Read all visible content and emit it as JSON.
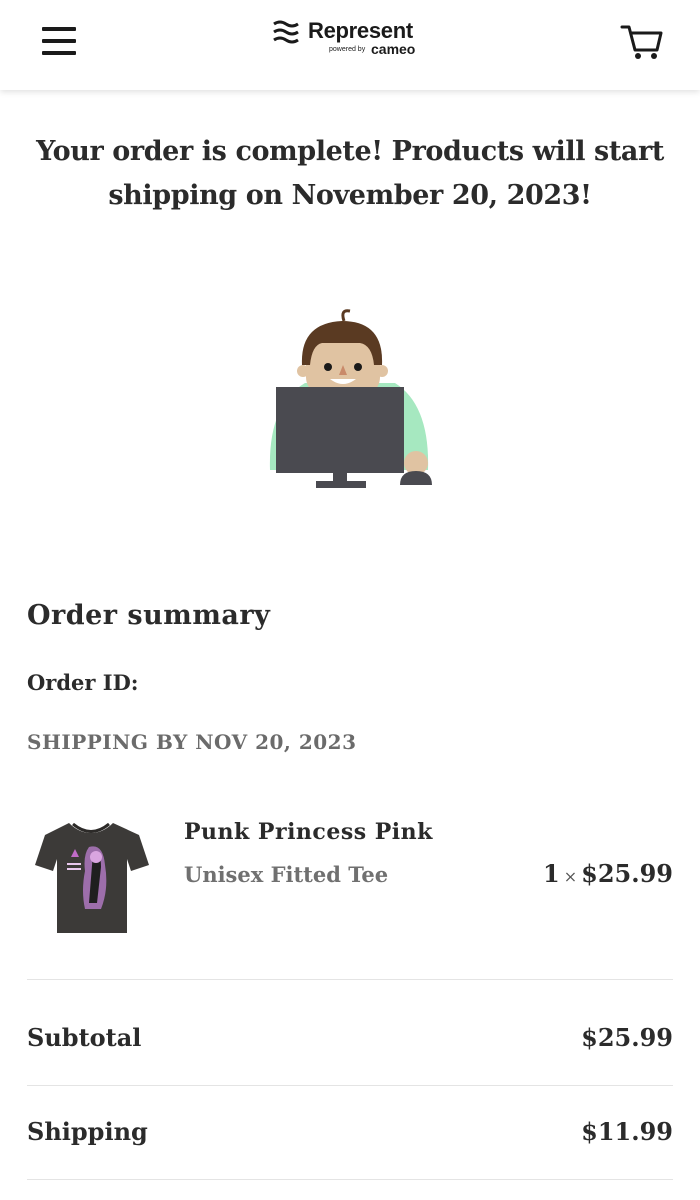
{
  "header": {
    "brand_name": "Represent",
    "brand_powered_by": "powered by",
    "brand_partner": "cameo",
    "menu_icon": "hamburger-menu-icon",
    "cart_icon": "shopping-cart-icon"
  },
  "confirmation": {
    "line1": "Your order is complete! Products will start",
    "line2": "shipping on November 20, 2023!"
  },
  "summary": {
    "heading": "Order summary",
    "order_id_label": "Order ID:",
    "order_id_value": "",
    "shipping_by": "SHIPPING BY NOV 20, 2023"
  },
  "items": [
    {
      "name": "Punk Princess Pink",
      "variant": "Unisex Fitted Tee",
      "quantity": "1",
      "times_symbol": "×",
      "price": "$25.99"
    }
  ],
  "totals": {
    "subtotal_label": "Subtotal",
    "subtotal_value": "$25.99",
    "shipping_label": "Shipping",
    "shipping_value": "$11.99"
  },
  "colors": {
    "text": "#2b2b2b",
    "muted": "#6b6b6b",
    "illustration_shirt": "#a6e8c0",
    "illustration_monitor": "#4a4a50",
    "illustration_hair": "#5a3a22",
    "illustration_skin": "#e0c3a2"
  }
}
